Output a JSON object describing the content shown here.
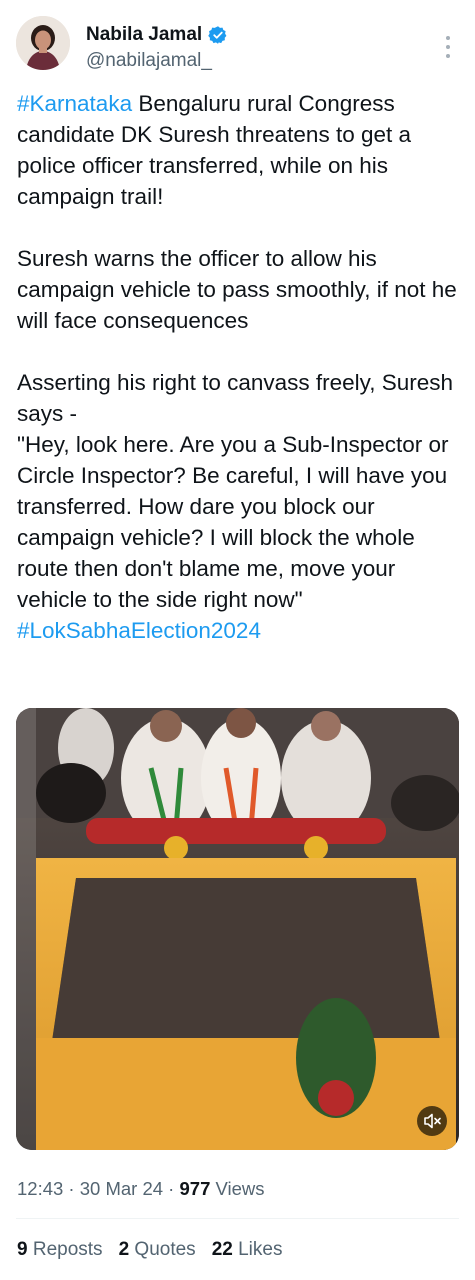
{
  "author": {
    "name": "Nabila Jamal",
    "handle": "@nabilajamal_",
    "verified_color": "#1d9bf0"
  },
  "tweet": {
    "p1_tag": "#Karnataka",
    "p1_rest": " Bengaluru rural Congress candidate DK Suresh threatens to get a police officer transferred, while on his campaign trail!",
    "p2": "Suresh warns the officer to allow his campaign vehicle to pass smoothly, if not he will face consequences",
    "p3": "Asserting his right to canvass freely, Suresh says -\n\"Hey, look here. Are you a Sub-Inspector or Circle Inspector? Be careful, I will have you transferred. How dare you block our campaign vehicle? I will block the whole route then don't blame me, move your vehicle to the side right now\"",
    "hashtag2": "#LokSabhaElection2024"
  },
  "media": {
    "type": "video",
    "mute_icon": "speaker-muted-icon"
  },
  "meta": {
    "time": "12:43",
    "sep1": " · ",
    "date": "30 Mar 24",
    "sep2": " · ",
    "views_count": "977",
    "views_label": " Views"
  },
  "stats": {
    "reposts_count": "9",
    "reposts_label": " Reposts",
    "quotes_count": "2",
    "quotes_label": " Quotes",
    "likes_count": "22",
    "likes_label": " Likes"
  },
  "colors": {
    "link": "#1d9bf0",
    "secondary_text": "#536471",
    "primary_text": "#0f1419"
  }
}
